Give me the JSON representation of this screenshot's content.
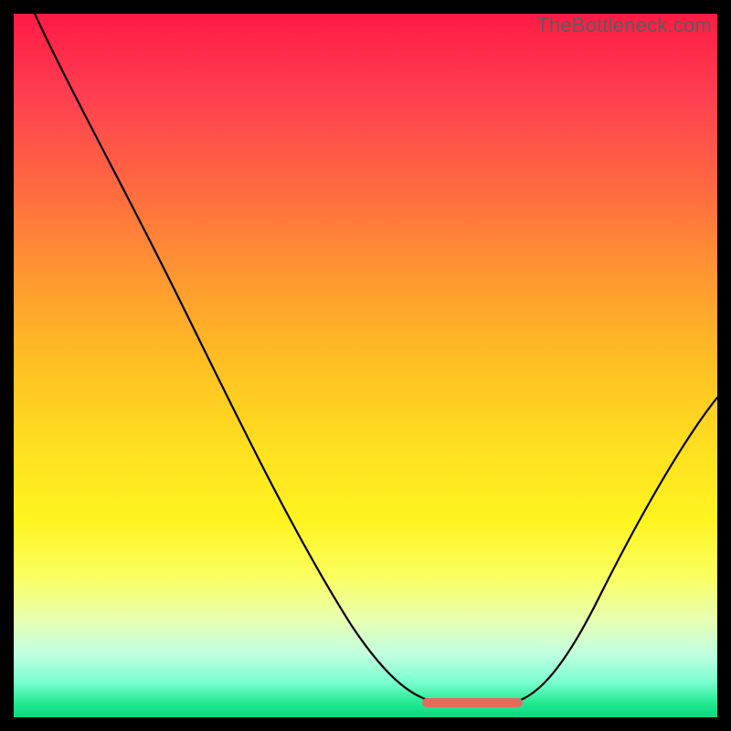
{
  "watermark": "TheBottleneck.com",
  "chart_data": {
    "type": "line",
    "title": "",
    "xlabel": "",
    "ylabel": "",
    "xlim": [
      0,
      100
    ],
    "ylim": [
      0,
      100
    ],
    "grid": false,
    "legend": false,
    "series": [
      {
        "name": "bottleneck-curve",
        "x": [
          3,
          10,
          20,
          30,
          40,
          50,
          57,
          60,
          64,
          68,
          72,
          78,
          85,
          92,
          100
        ],
        "y": [
          100,
          88,
          72,
          55,
          38,
          22,
          10,
          5,
          2,
          1,
          2,
          8,
          22,
          40,
          58
        ],
        "color": "#000000"
      },
      {
        "name": "optimal-range",
        "x": [
          58,
          72
        ],
        "y": [
          1,
          1
        ],
        "color": "#e46a5e"
      }
    ],
    "background_gradient": {
      "top": "#ff1a44",
      "mid": "#ffe020",
      "bottom": "#10d880"
    }
  }
}
